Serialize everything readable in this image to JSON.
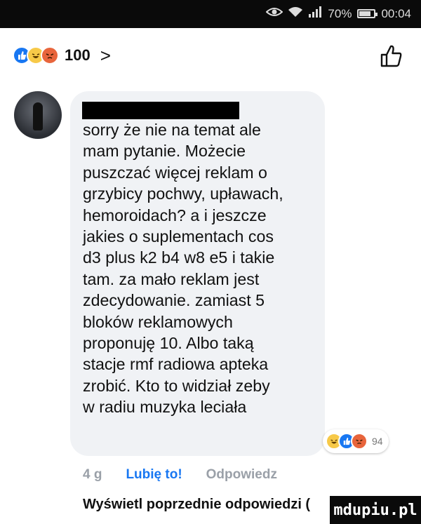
{
  "status": {
    "battery": "70%",
    "time": "00:04",
    "battery_level": 0.7
  },
  "reactions_summary": {
    "count": "100",
    "chevron": ">",
    "icons": [
      "like-icon",
      "haha-icon",
      "angry-icon"
    ],
    "colors": {
      "like": "#1877f2",
      "haha": "#f7c948",
      "angry": "#e8653c"
    }
  },
  "comment": {
    "text": "sorry że nie na temat ale\nmam pytanie. Możecie\npuszczać więcej reklam o\ngrzybicy pochwy, upławach,\nhemoroidach? a i jeszcze\njakies o suplementach cos\nd3 plus k2 b4 w8 e5 i takie\ntam. za mało reklam jest\nzdecydowanie. zamiast 5\nbloków reklamowych\nproponuję 10. Albo taką\nstacje rmf radiowa apteka\nzrobić. Kto to widział zeby\nw radiu muzyka leciała",
    "reaction_count": "94",
    "time": "4 g",
    "like_label": "Lubię to!",
    "reply_label": "Odpowiedz"
  },
  "previous_replies": {
    "label": "Wyświetl poprzednie odpowiedzi ("
  },
  "watermark": {
    "text": "mdupiu.pl"
  }
}
